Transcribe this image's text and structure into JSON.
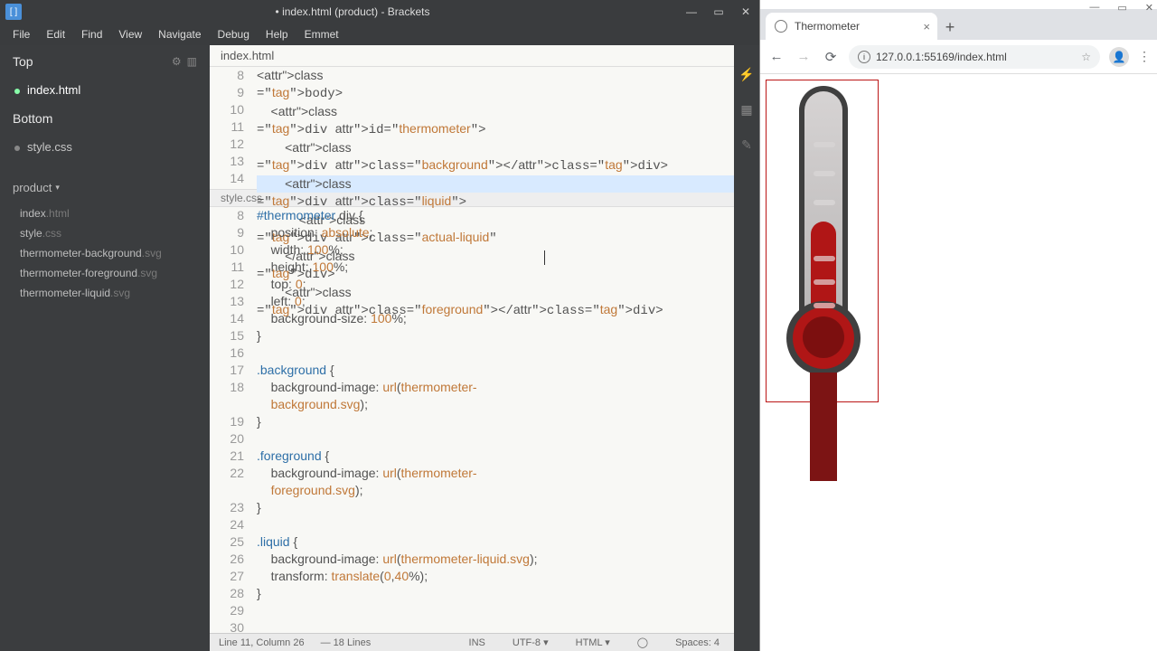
{
  "brackets": {
    "title": "• index.html (product) - Brackets",
    "menu": [
      "File",
      "Edit",
      "Find",
      "View",
      "Navigate",
      "Debug",
      "Help",
      "Emmet"
    ],
    "sidebar": {
      "top_label": "Top",
      "bottom_label": "Bottom",
      "working_top": [
        {
          "name": "index.html",
          "active": true
        }
      ],
      "working_bottom": [
        {
          "name": "style.css",
          "active": false
        }
      ],
      "project_label": "product",
      "project_files": [
        {
          "base": "index",
          "ext": ".html"
        },
        {
          "base": "style",
          "ext": ".css"
        },
        {
          "base": "thermometer-background",
          "ext": ".svg"
        },
        {
          "base": "thermometer-foreground",
          "ext": ".svg"
        },
        {
          "base": "thermometer-liquid",
          "ext": ".svg"
        }
      ]
    },
    "tab1": "index.html",
    "tab2": "style.css",
    "pane1_start": 8,
    "pane1": [
      "<body>",
      "    <div id=\"thermometer\">",
      "        <div class=\"background\"></div>",
      "        <div class=\"liquid\">",
      "            <div class=\"actual-liquid\"",
      "        </div>",
      "        <div class=\"foreground\"></div>"
    ],
    "pane2_start": 8,
    "pane2": [
      "#thermometer div {",
      "    position: absolute;",
      "    width: 100%;",
      "    height: 100%;",
      "    top: 0;",
      "    left: 0;",
      "    background-size: 100%;",
      "}",
      "",
      ".background {",
      "    background-image: url(thermometer-",
      "    background.svg);",
      "}",
      "",
      ".foreground {",
      "    background-image: url(thermometer-",
      "    foreground.svg);",
      "}",
      "",
      ".liquid {",
      "    background-image: url(thermometer-liquid.svg);",
      "    transform: translate(0,40%);",
      "}",
      "",
      ""
    ],
    "status": {
      "pos": "Line 11, Column 26",
      "sel": "— 18 Lines",
      "ins": "INS",
      "enc": "UTF-8",
      "lang": "HTML",
      "spaces": "Spaces: 4"
    }
  },
  "browser": {
    "tab_title": "Thermometer",
    "url": "127.0.0.1:55169/index.html"
  }
}
